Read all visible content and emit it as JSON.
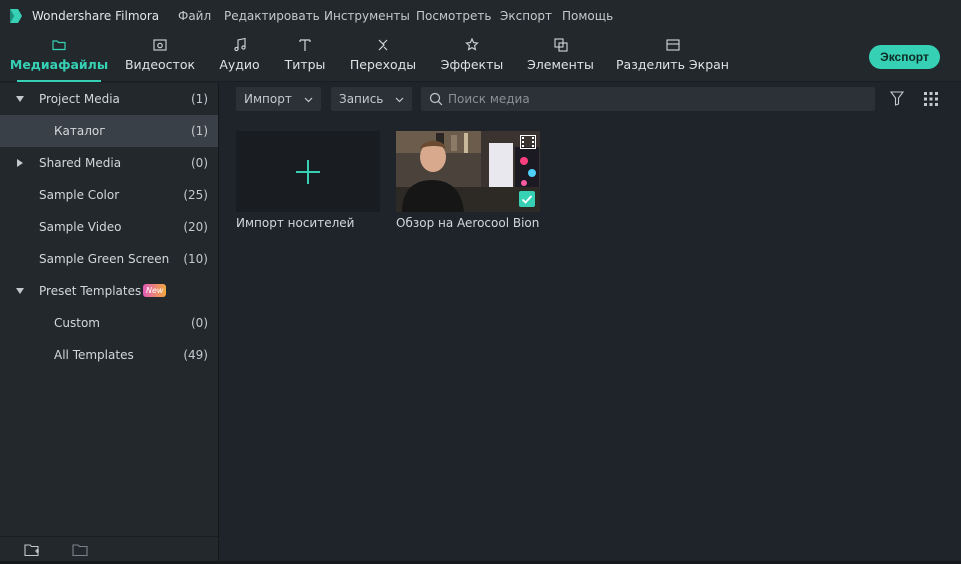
{
  "app": {
    "title": "Wondershare Filmora"
  },
  "menu": [
    "Файл",
    "Редактировать",
    "Инструменты",
    "Посмотреть",
    "Экспорт",
    "Помощь"
  ],
  "toolbar": {
    "tabs": [
      {
        "label": "Медиафайлы",
        "icon": "folder-icon",
        "active": true
      },
      {
        "label": "Видеосток",
        "icon": "stock-video-icon"
      },
      {
        "label": "Аудио",
        "icon": "music-note-icon"
      },
      {
        "label": "Титры",
        "icon": "text-icon"
      },
      {
        "label": "Переходы",
        "icon": "transition-icon"
      },
      {
        "label": "Эффекты",
        "icon": "effects-star-icon"
      },
      {
        "label": "Элементы",
        "icon": "elements-icon"
      },
      {
        "label": "Разделить Экран",
        "icon": "split-screen-icon"
      }
    ],
    "export_label": "Экспорт"
  },
  "sidebar": {
    "items": [
      {
        "label": "Project Media",
        "count": "(1)",
        "caret": "down"
      },
      {
        "label": "Каталог",
        "count": "(1)",
        "selected": true
      },
      {
        "label": "Shared Media",
        "count": "(0)",
        "caret": "right"
      },
      {
        "label": "Sample Color",
        "count": "(25)"
      },
      {
        "label": "Sample Video",
        "count": "(20)"
      },
      {
        "label": "Sample Green Screen",
        "count": "(10)"
      },
      {
        "label": "Preset Templates",
        "badge": "New",
        "caret": "down"
      },
      {
        "label": "Custom",
        "count": "(0)"
      },
      {
        "label": "All Templates",
        "count": "(49)"
      }
    ]
  },
  "main": {
    "import_dropdown": "Импорт",
    "record_dropdown": "Запись",
    "search_placeholder": "Поиск медиа",
    "media": [
      {
        "label": "Импорт носителей",
        "type": "import"
      },
      {
        "label": "Обзор на Aerocool Bioni...",
        "type": "video",
        "checked": true
      }
    ]
  },
  "colors": {
    "accent": "#36d1b5",
    "background": "#1e2328",
    "panel": "#23282d",
    "selected": "#3a4047"
  }
}
